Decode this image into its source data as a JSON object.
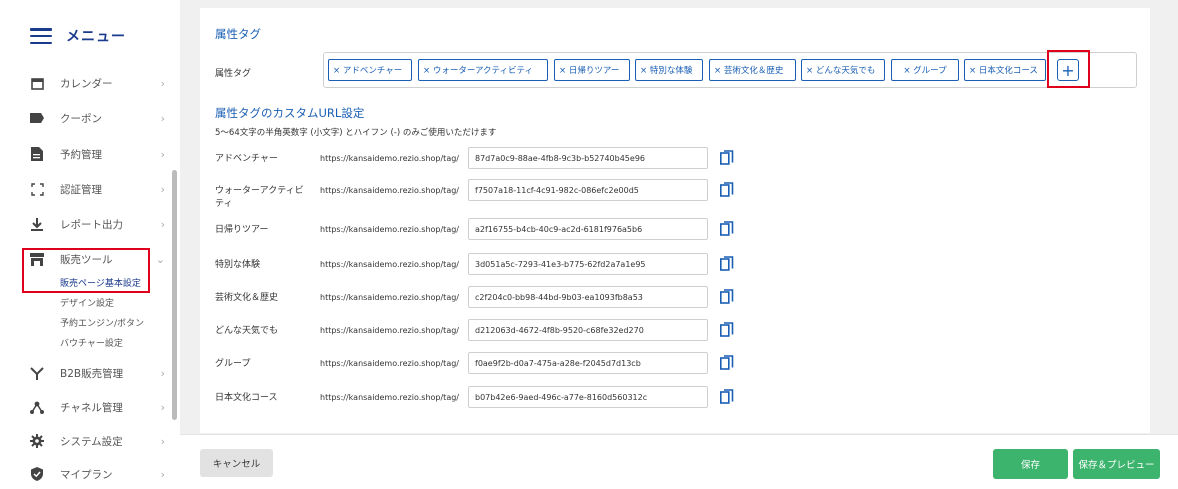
{
  "sidebar": {
    "menu_title": "メニュー",
    "items": [
      {
        "label": "カレンダー",
        "icon": "calendar-icon"
      },
      {
        "label": "クーポン",
        "icon": "coupon-icon"
      },
      {
        "label": "予約管理",
        "icon": "document-icon"
      },
      {
        "label": "認証管理",
        "icon": "scan-icon"
      },
      {
        "label": "レポート出力",
        "icon": "download-icon"
      },
      {
        "label": "販売ツール",
        "icon": "store-icon"
      },
      {
        "label": "B2B販売管理",
        "icon": "b2b-icon"
      },
      {
        "label": "チャネル管理",
        "icon": "channel-icon"
      },
      {
        "label": "システム設定",
        "icon": "gear-icon"
      },
      {
        "label": "マイプラン",
        "icon": "shield-icon"
      }
    ],
    "sub_items": [
      {
        "label": "販売ページ基本設定",
        "active": true
      },
      {
        "label": "デザイン設定"
      },
      {
        "label": "予約エンジン/ボタン"
      },
      {
        "label": "バウチャー設定"
      }
    ]
  },
  "attributes": {
    "section_title": "属性タグ",
    "field_label": "属性タグ",
    "tags": [
      "× アドベンチャー",
      "× ウォーターアクティビティ",
      "× 日帰りツアー",
      "× 特別な体験",
      "× 芸術文化＆歴史",
      "× どんな天気でも",
      "× グループ",
      "× 日本文化コース"
    ],
    "plus_label": "+"
  },
  "custom_url": {
    "section_title": "属性タグのカスタムURL設定",
    "note": "5〜64文字の半角英数字 (小文字) とハイフン (-) のみご使用いただけます",
    "prefix": "https://kansaidemo.rezio.shop/tag/",
    "rows": [
      {
        "label": "アドベンチャー",
        "value": "87d7a0c9-88ae-4fb8-9c3b-b52740b45e96"
      },
      {
        "label": "ウォーターアクティビティ",
        "value": "f7507a18-11cf-4c91-982c-086efc2e00d5"
      },
      {
        "label": "日帰りツアー",
        "value": "a2f16755-b4cb-40c9-ac2d-6181f976a5b6"
      },
      {
        "label": "特別な体験",
        "value": "3d051a5c-7293-41e3-b775-62fd2a7a1e95"
      },
      {
        "label": "芸術文化＆歴史",
        "value": "c2f204c0-bb98-44bd-9b03-ea1093fb8a53"
      },
      {
        "label": "どんな天気でも",
        "value": "d212063d-4672-4f8b-9520-c68fe32ed270"
      },
      {
        "label": "グループ",
        "value": "f0ae9f2b-d0a7-475a-a28e-f2045d7d13cb"
      },
      {
        "label": "日本文化コース",
        "value": "b07b42e6-9aed-496c-a77e-8160d560312c"
      }
    ]
  },
  "footer": {
    "cancel_label": "キャンセル",
    "save_label": "保存",
    "preview_label": "保存＆プレビュー"
  },
  "colors": {
    "accent": "#1a5fb4",
    "highlight": "#e0001b",
    "save": "#3cb46e"
  }
}
